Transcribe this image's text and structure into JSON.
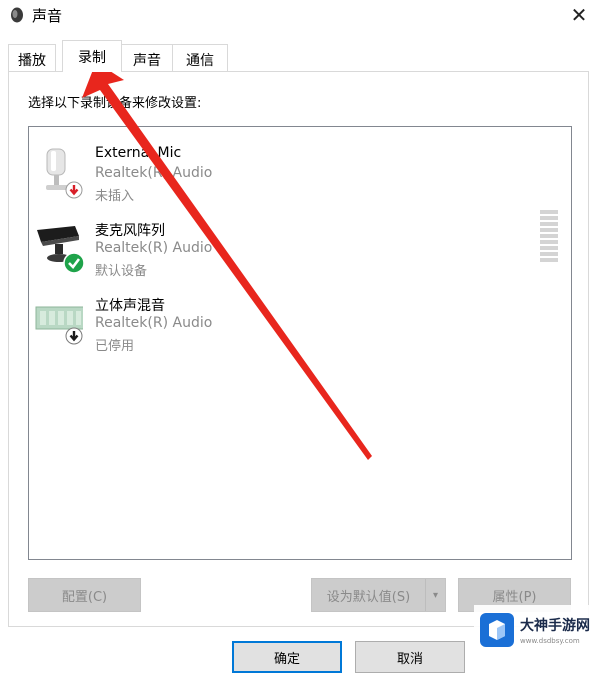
{
  "window": {
    "title": "声音",
    "close_glyph": "✕"
  },
  "tabs": [
    {
      "label": "播放",
      "active": false
    },
    {
      "label": "录制",
      "active": true
    },
    {
      "label": "声音",
      "active": false
    },
    {
      "label": "通信",
      "active": false
    }
  ],
  "instruction": "选择以下录制设备来修改设置:",
  "devices": [
    {
      "name": "External Mic",
      "driver": "Realtek(R) Audio",
      "status": "未插入",
      "icon": "microphone-icon",
      "badge": "unplugged-badge-icon"
    },
    {
      "name": "麦克风阵列",
      "driver": "Realtek(R) Audio",
      "status": "默认设备",
      "icon": "microphone-array-icon",
      "badge": "default-check-badge-icon"
    },
    {
      "name": "立体声混音",
      "driver": "Realtek(R) Audio",
      "status": "已停用",
      "icon": "stereo-mix-icon",
      "badge": "disabled-down-badge-icon"
    }
  ],
  "buttons": {
    "configure": "配置(C)",
    "set_default": "设为默认值(S)",
    "properties": "属性(P)",
    "ok": "确定",
    "cancel": "取消"
  },
  "watermark": {
    "text": "大神手游网",
    "sub": "www.dsdbsy.com"
  },
  "colors": {
    "annotation_arrow": "#e8261d",
    "accent": "#0078d7",
    "check_green": "#1fa34a",
    "unplugged_red": "#d81e28"
  }
}
